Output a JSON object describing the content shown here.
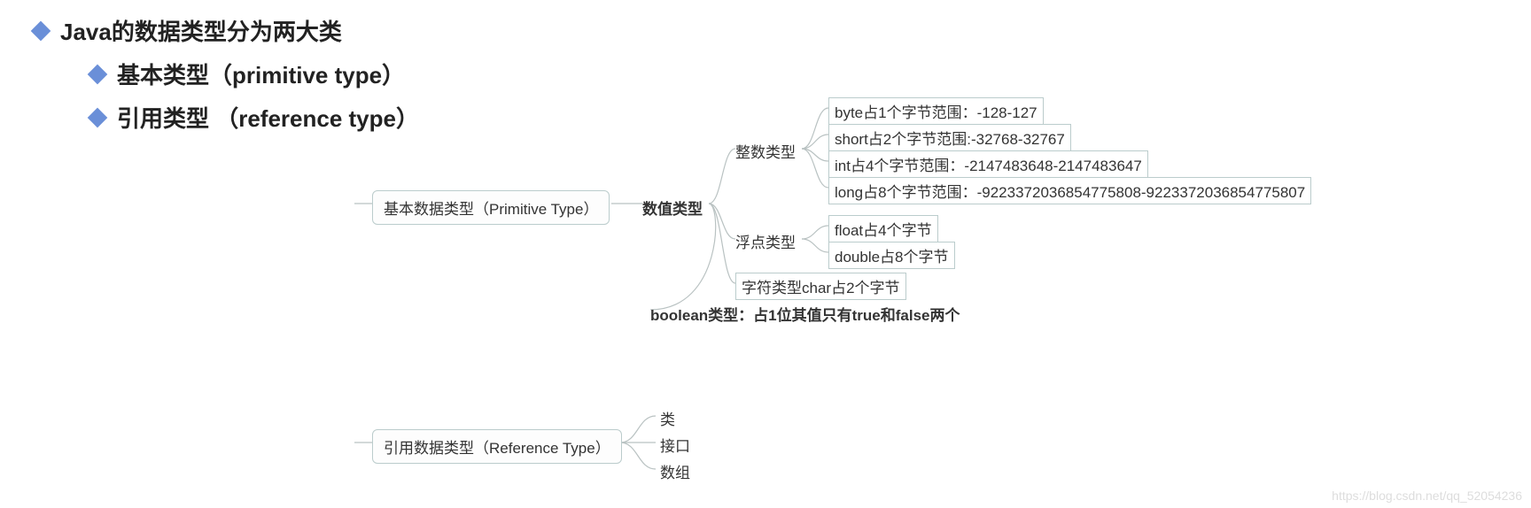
{
  "bullets": {
    "main": "Java的数据类型分为两大类",
    "sub1": "基本类型（primitive type）",
    "sub2": "引用类型 （reference type）"
  },
  "mindmap": {
    "primitive": "基本数据类型（Primitive Type）",
    "reference": "引用数据类型（Reference Type）",
    "numeric": "数值类型",
    "integer": "整数类型",
    "float": "浮点类型",
    "byteRow": "byte占1个字节范围：-128-127",
    "shortRow": "short占2个字节范围:-32768-32767",
    "intRow": "int占4个字节范围：-2147483648-2147483647",
    "longRow": "long占8个字节范围：-9223372036854775808-9223372036854775807",
    "floatRow": "float占4个字节",
    "doubleRow": "double占8个字节",
    "charRow": "字符类型char占2个字节",
    "booleanRow": "boolean类型：占1位其值只有true和false两个",
    "refClass": "类",
    "refInterface": "接口",
    "refArray": "数组"
  },
  "watermark": "https://blog.csdn.net/qq_52054236"
}
